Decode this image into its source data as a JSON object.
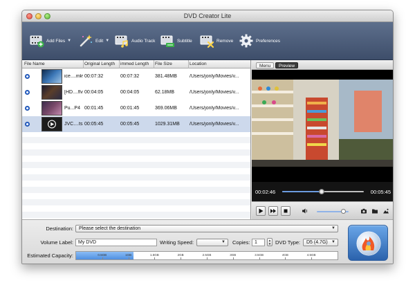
{
  "window": {
    "title": "DVD Creator Lite"
  },
  "toolbar": {
    "add_files": "Add Files",
    "edit": "Edit",
    "audio_track": "Audio Track",
    "subtitle": "Subtitle",
    "remove": "Remove",
    "preferences": "Preferences"
  },
  "filelist": {
    "columns": [
      "File Name",
      "Original Length",
      "Trimmed Length",
      "File Size",
      "Location"
    ],
    "column_display": [
      "File Name",
      "Original Length",
      "immed Length",
      "File Size",
      "Location"
    ],
    "rows": [
      {
        "name": "ice....mkv",
        "original": "00:07:32",
        "trimmed": "00:07:32",
        "size": "381.48MB",
        "location": "/Users/jonly/Movies/v..."
      },
      {
        "name": "[HD....flv",
        "original": "00:04:05",
        "trimmed": "00:04:05",
        "size": "62.18MB",
        "location": "/Users/jonly/Movies/v..."
      },
      {
        "name": "Pu...P4",
        "original": "00:01:45",
        "trimmed": "00:01:45",
        "size": "369.06MB",
        "location": "/Users/jonly/Movies/v..."
      },
      {
        "name": "JVC....ts",
        "original": "00:05:45",
        "trimmed": "00:05:45",
        "size": "1029.31MB",
        "location": "/Users/jonly/Movies/v..."
      }
    ],
    "selected_index": 3
  },
  "preview": {
    "tab_menu": "Menu",
    "tab_preview": "Preview",
    "active_tab": "Preview",
    "current_time": "00:02:46",
    "total_time": "00:05:45",
    "progress_fraction": 0.48,
    "volume_fraction": 0.85
  },
  "settings": {
    "destination_label": "Destination:",
    "destination_value": "Please select the destination",
    "volume_label_label": "Volume Label:",
    "volume_label_value": "My DVD",
    "writing_speed_label": "Writing Speed:",
    "writing_speed_value": "",
    "copies_label": "Copies:",
    "copies_value": "1",
    "dvd_type_label": "DVD Type:",
    "dvd_type_value": "D5 (4.7G)",
    "capacity_label": "Estimated Capacity:",
    "capacity_ticks": [
      "0.5GB",
      "1GB",
      "1.5GB",
      "2GB",
      "2.5GB",
      "3GB",
      "3.5GB",
      "4GB",
      "4.5GB"
    ],
    "capacity_fill_fraction": 0.22
  },
  "colors": {
    "toolbar": "#4a5a78",
    "selected_row": "#cdd9ec",
    "capacity_fill": "#5b97e4",
    "burn_button": "#3f7cc8"
  }
}
